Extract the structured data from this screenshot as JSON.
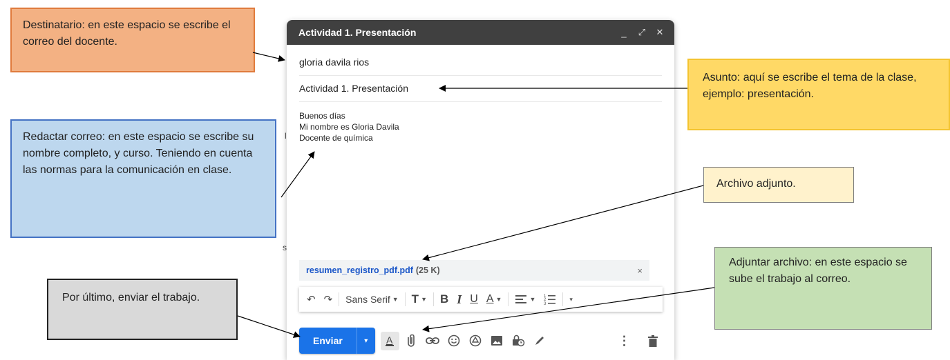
{
  "compose": {
    "title": "Actividad 1. Presentación",
    "controls": {
      "minimize": "_",
      "expand": "⤢",
      "close": "✕"
    },
    "to_value": "gloria davila rios",
    "subject_value": "Actividad 1. Presentación",
    "body_lines": [
      "Buenos días",
      "Mi nombre es Gloria Davila",
      "Docente de química"
    ],
    "attachment": {
      "name": "resumen_registro_pdf.pdf",
      "size": "(25 K)",
      "close": "×"
    },
    "format_bar": {
      "undo": "↶",
      "redo": "↷",
      "font": "Sans Serif",
      "size": "T",
      "bold": "B",
      "italic": "I",
      "underline": "U",
      "text_color": "A",
      "more": "▾"
    },
    "send_label": "Enviar",
    "send_more": "▾",
    "bottom_icons": [
      "text-format-icon",
      "attach-icon",
      "link-icon",
      "emoji-icon",
      "drive-icon",
      "photo-icon",
      "lock-clock-icon",
      "signature-icon"
    ],
    "more_options": "⋮",
    "delete": "🗑"
  },
  "stray_text": {
    "a": "l",
    "b": "s"
  },
  "callouts": {
    "destinatario": "Destinatario: en este espacio se escribe el correo del docente.",
    "asunto": "Asunto: aquí se escribe el tema de la clase, ejemplo: presentación.",
    "redactar": "Redactar correo: en este espacio se escribe su nombre completo, y curso. Teniendo en cuenta las normas para la comunicación en clase.",
    "archivo": "Archivo adjunto.",
    "adjuntar": "Adjuntar archivo: en este espacio se sube el trabajo al correo.",
    "enviar": "Por último, enviar el trabajo."
  },
  "colors": {
    "header_bg": "#404040",
    "send_blue": "#1a73e8",
    "attachment_link": "#1a56c8",
    "orange_box": "#f3b183",
    "yellow_box": "#ffd966",
    "blue_box": "#bdd7ee",
    "cream_box": "#fff2cc",
    "green_box": "#c5e0b4",
    "gray_box": "#d9d9d9"
  }
}
